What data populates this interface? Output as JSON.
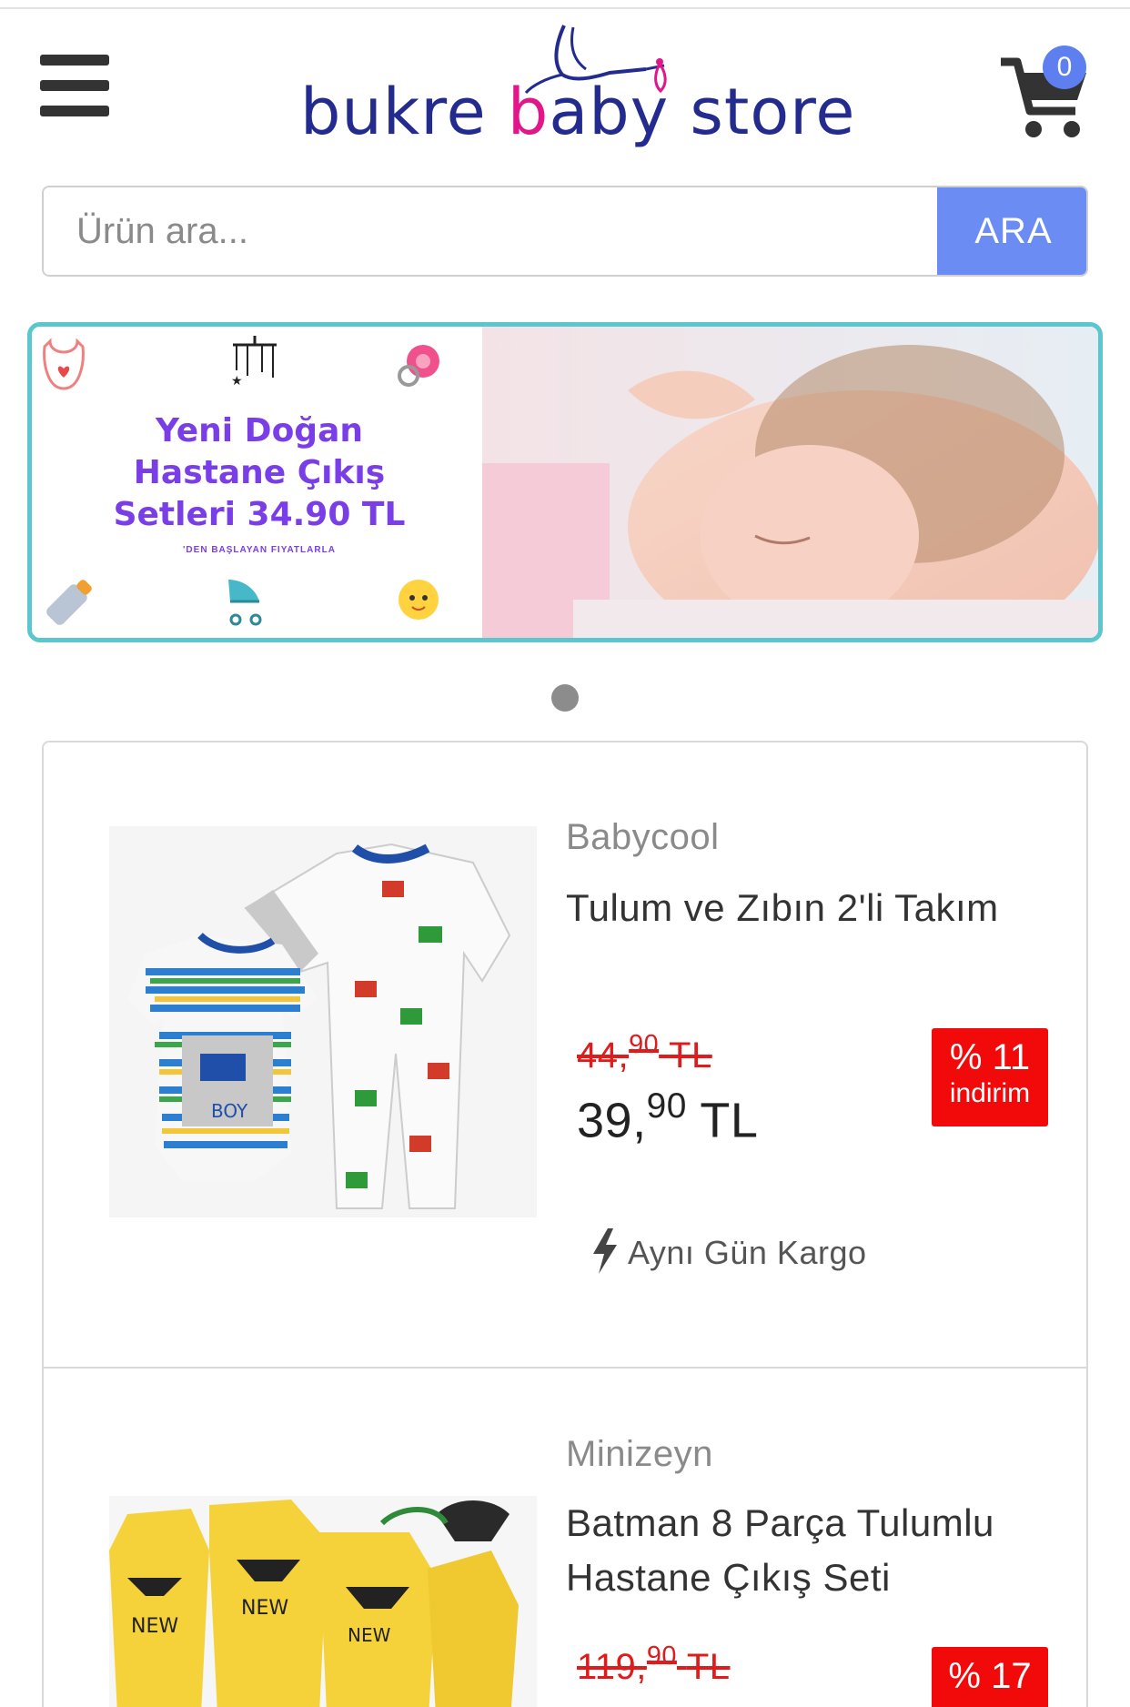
{
  "header": {
    "logo_words": [
      "bukre",
      "b",
      "a",
      "b",
      "y",
      "store"
    ],
    "cart_count": "0"
  },
  "search": {
    "placeholder": "Ürün ara...",
    "button_label": "ARA"
  },
  "banner": {
    "title_lines": [
      "Yeni Doğan",
      "Hastane Çıkış",
      "Setleri 34.90 TL"
    ],
    "subtitle": "'DEN BAŞLAYAN FIYATLARLA"
  },
  "products": [
    {
      "brand": "Babycool",
      "name": "Tulum ve Zıbın 2'li Takım",
      "old_price_int": "44,",
      "old_price_dec": "90",
      "old_price_cur": "TL",
      "new_price_int": "39,",
      "new_price_dec": "90",
      "new_price_cur": "TL",
      "discount_pct": "% 11",
      "discount_label": "indirim",
      "shipping": "Aynı Gün Kargo"
    },
    {
      "brand": "Minizeyn",
      "name": "Batman 8 Parça Tulumlu Hastane Çıkış Seti",
      "old_price_int": "119,",
      "old_price_dec": "90",
      "old_price_cur": "TL",
      "discount_pct": "% 17"
    }
  ],
  "colors": {
    "accent": "#6b8cf2",
    "discount": "#f20a0a",
    "banner_border": "#5cc6cf",
    "logo_blue": "#232b8f",
    "logo_pink": "#e0168a"
  }
}
